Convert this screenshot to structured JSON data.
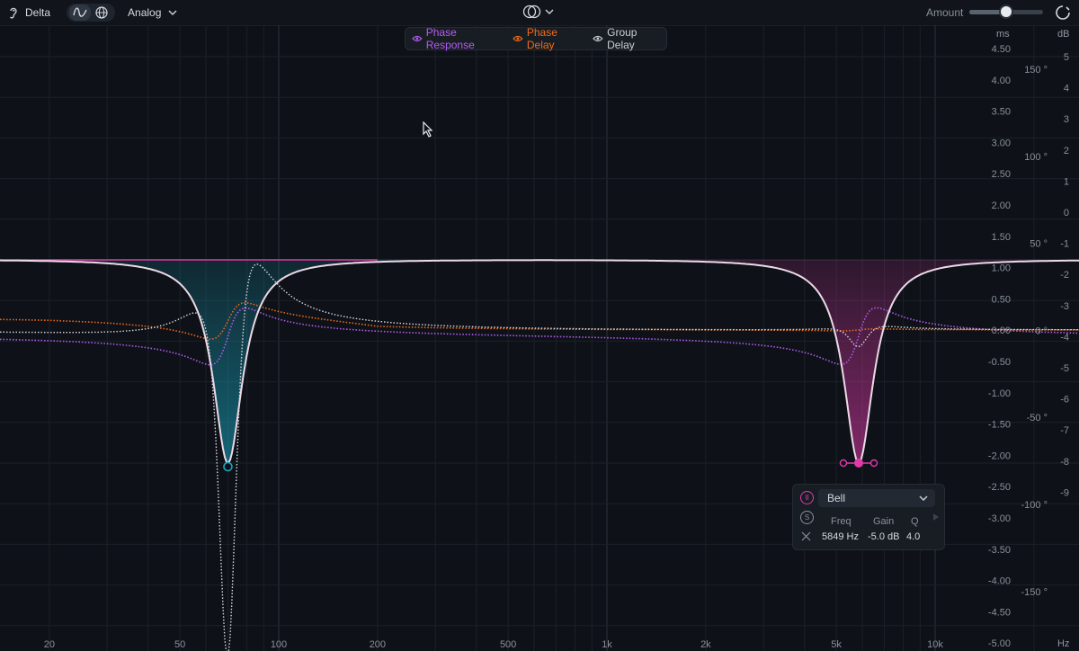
{
  "toolbar": {
    "delta_label": "Delta",
    "mode": "Analog",
    "amount_label": "Amount",
    "amount_value": 0.5
  },
  "legend": [
    {
      "label": "Phase Response",
      "color": "#b35cf0",
      "icon": "eye-icon"
    },
    {
      "label": "Phase Delay",
      "color": "#f06a1a",
      "icon": "eye-icon"
    },
    {
      "label": "Group Delay",
      "color": "#c9cdd3",
      "icon": "eye-icon"
    }
  ],
  "axes": {
    "ms_unit": "ms",
    "db_unit": "dB",
    "hz_unit": "Hz",
    "ms_ticks": [
      "4.50",
      "4.00",
      "3.50",
      "3.00",
      "2.50",
      "2.00",
      "1.50",
      "1.00",
      "0.50",
      "0.00",
      "-0.50",
      "-1.00",
      "-1.50",
      "-2.00",
      "-2.50",
      "-3.00",
      "-3.50",
      "-4.00",
      "-4.50",
      "-5.00"
    ],
    "db_ticks": [
      "5",
      "4",
      "3",
      "2",
      "1",
      "0",
      "-1",
      "-2",
      "-3",
      "-4",
      "-5",
      "-6",
      "-7",
      "-8",
      "-9"
    ],
    "deg_ticks": [
      "150 °",
      "100 °",
      "50 °",
      "0 °",
      "-50 °",
      "-100 °",
      "-150 °"
    ],
    "freq_ticks": [
      "20",
      "50",
      "100",
      "200",
      "500",
      "1k",
      "2k",
      "5k",
      "10k"
    ]
  },
  "bands": [
    {
      "freq": 70,
      "gain": -5.0,
      "q": 4.0,
      "color": "#1aa6c0"
    },
    {
      "freq": 5849,
      "gain": -5.0,
      "q": 4.0,
      "color": "#e03aa8"
    }
  ],
  "band_panel": {
    "type": "Bell",
    "freq_label": "Freq",
    "gain_label": "Gain",
    "q_label": "Q",
    "freq_value": "5849 Hz",
    "gain_value": "-5.0 dB",
    "q_value": "4.0"
  }
}
